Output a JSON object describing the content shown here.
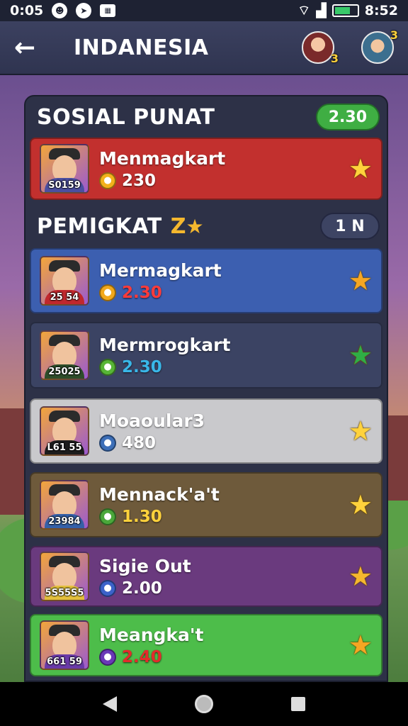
{
  "status_bar": {
    "time_left": "0:05",
    "time_right": "8:52",
    "icons": [
      "notification-icon",
      "location-icon",
      "app-icon",
      "wifi-icon",
      "signal-icon",
      "battery-icon"
    ]
  },
  "header": {
    "title": "INDANESIA",
    "avatar1_badge": "3",
    "avatar2_badge": "3"
  },
  "section1": {
    "title": "SOSIAL PUNAT",
    "pill": "2.30"
  },
  "section2": {
    "title": "PEMIGKAT",
    "rank_mark": "Z",
    "pill": "1 N"
  },
  "rows": [
    {
      "name": "Menmagkart",
      "score": "230",
      "avatar_num": "S0159",
      "bg": "#c2302e",
      "score_color": "#ffffff",
      "coin_color": "#f2b21b",
      "star_color": "#ffd23c",
      "body": "#4b4fa0"
    },
    {
      "name": "Mermagkart",
      "score": "2.30",
      "avatar_num": "25 54",
      "bg": "#3c5fb0",
      "score_color": "#ff3b3b",
      "coin_color": "#f2a81b",
      "star_color": "#f5a623",
      "body": "#c0282d"
    },
    {
      "name": "Mermrogkart",
      "score": "2.30",
      "avatar_num": "25025",
      "bg": "#3b4363",
      "score_color": "#39b7e8",
      "coin_color": "#57b536",
      "star_color": "#2fae45",
      "body": "#2e4d2a"
    },
    {
      "name": "Moaoular3",
      "score": "480",
      "avatar_num": "L61 55",
      "bg": "#c9c9cc",
      "score_color": "#ffffff",
      "coin_color": "#3d6fb8",
      "star_color": "#ffd23c",
      "body": "#1d1d1d"
    },
    {
      "name": "Mennack'a't",
      "score": "1.30",
      "avatar_num": "23984",
      "bg": "#6e5a3b",
      "score_color": "#ffd23c",
      "coin_color": "#4aa83a",
      "star_color": "#ffd23c",
      "body": "#3560a8"
    },
    {
      "name": "Sigie Out",
      "score": "2.00",
      "avatar_num": "5S55S5",
      "bg": "#6a3a7e",
      "score_color": "#ffffff",
      "coin_color": "#3b62c9",
      "star_color": "#f5b82e",
      "body": "#e3c03c"
    },
    {
      "name": "Meangka't",
      "score": "2.40",
      "avatar_num": "661 59",
      "bg": "#4dbd4a",
      "score_color": "#e32b2b",
      "coin_color": "#6a39b8",
      "star_color": "#f5a623",
      "body": "#6a3aa8"
    }
  ]
}
